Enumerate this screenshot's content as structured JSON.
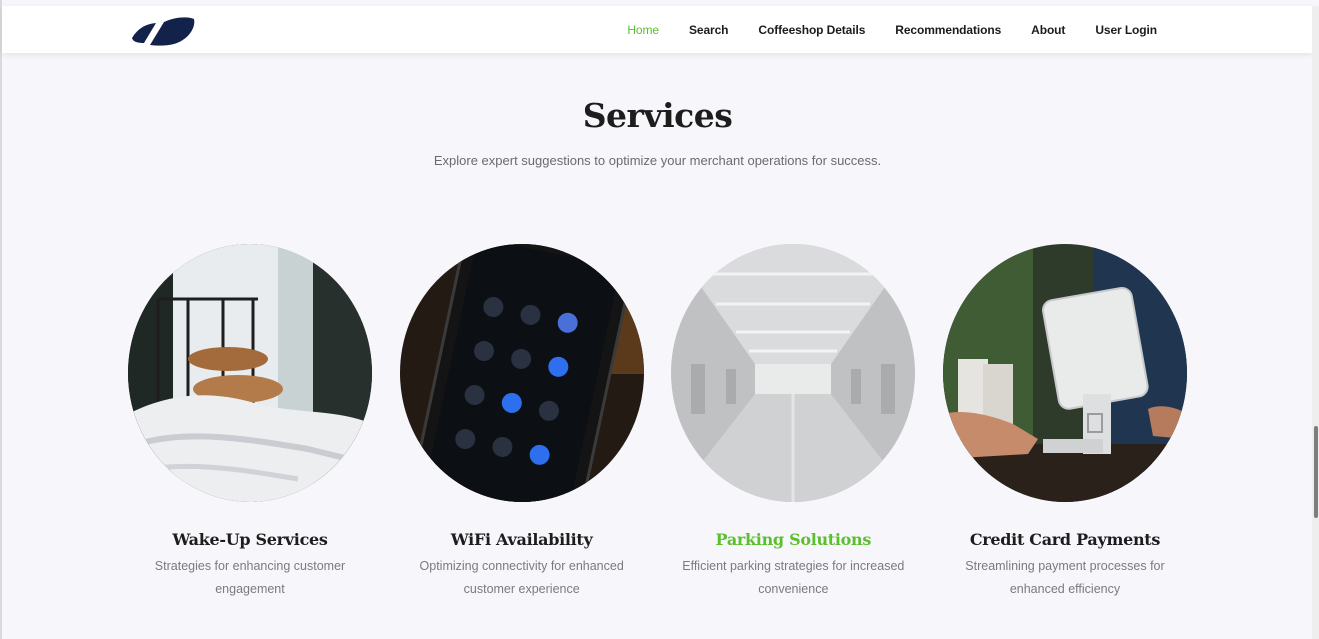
{
  "nav": {
    "items": [
      {
        "label": "Home",
        "active": true
      },
      {
        "label": "Search",
        "active": false
      },
      {
        "label": "Coffeeshop Details",
        "active": false
      },
      {
        "label": "Recommendations",
        "active": false
      },
      {
        "label": "About",
        "active": false
      },
      {
        "label": "User Login",
        "active": false
      }
    ]
  },
  "section": {
    "title": "Services",
    "subtitle": "Explore expert suggestions to optimize your merchant operations for success."
  },
  "services": [
    {
      "title": "Wake-Up Services",
      "description": "Strategies for enhancing customer engagement",
      "icon": "bedroom-photo"
    },
    {
      "title": "WiFi Availability",
      "description": "Optimizing connectivity for enhanced customer experience",
      "icon": "smartphone-photo"
    },
    {
      "title": "Parking Solutions",
      "description": "Efficient parking strategies for increased convenience",
      "icon": "parking-garage-photo",
      "highlighted": true
    },
    {
      "title": "Credit Card Payments",
      "description": "Streamlining payment processes for enhanced efficiency",
      "icon": "card-terminal-photo"
    }
  ],
  "colors": {
    "accent": "#5bbf2e",
    "logo": "#13224a",
    "background": "#f7f6fb"
  }
}
